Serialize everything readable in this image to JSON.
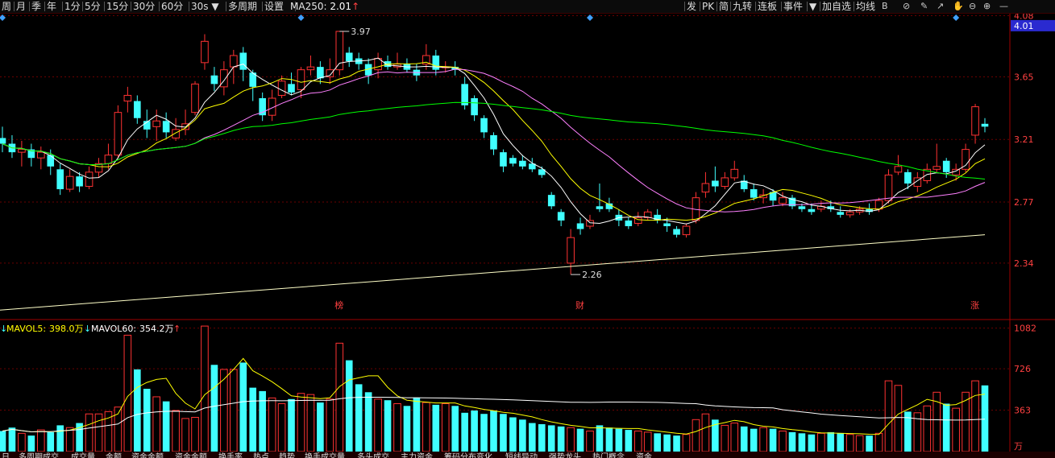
{
  "toolbar": {
    "left_items": [
      "周",
      "月",
      "季",
      "年",
      "1分",
      "5分",
      "15分",
      "30分",
      "60分",
      "30s ▼",
      "多周期",
      "设置"
    ],
    "ma250_label": "MA250:",
    "ma250_value": "2.01",
    "right_items": [
      "发",
      "PK",
      "简",
      "九转",
      "连板",
      "事件",
      "▼",
      "加自选",
      "均线"
    ]
  },
  "price_axis": {
    "ticks": [
      "4.08",
      "3.65",
      "3.21",
      "2.77",
      "2.34"
    ],
    "current": "4.01"
  },
  "volume_axis": {
    "ticks": [
      "1082",
      "726",
      "363"
    ],
    "unit": "万"
  },
  "volume_legend": {
    "mavol5_label": "MAVOL5:",
    "mavol5_value": "398.0万",
    "mavol60_label": "MAVOL60:",
    "mavol60_value": "354.2万"
  },
  "annotations": {
    "high": "3.97",
    "low": "2.26"
  },
  "event_markers": [
    "榜",
    "财",
    "涨"
  ],
  "bottom_tabs": [
    "日",
    "多周期成交",
    "成交量",
    "金额",
    "资金金额",
    "资金金额",
    "换手率",
    "热点",
    "趋势",
    "换手成交量",
    "多头成交",
    "主力资金",
    "筹码分布变化",
    "短线异动",
    "强势龙头",
    "热门概念",
    "资金"
  ],
  "colors": {
    "up": "#ff3232",
    "down": "#40ffff",
    "ma5": "#ffffff",
    "ma10": "#ffff00",
    "ma20": "#ff80ff",
    "ma60": "#00ff00",
    "ma250": "#ffffc8",
    "grid": "#6a0000"
  },
  "chart_data": {
    "type": "candlestick",
    "price_range": [
      2.0,
      4.1
    ],
    "volume_range": [
      0,
      1150
    ],
    "candles": [
      [
        3.22,
        3.18,
        3.3,
        3.12,
        180
      ],
      [
        3.18,
        3.12,
        3.24,
        3.08,
        210
      ],
      [
        3.12,
        3.14,
        3.2,
        3.02,
        160
      ],
      [
        3.14,
        3.08,
        3.18,
        3.02,
        140
      ],
      [
        3.08,
        3.12,
        3.16,
        3.0,
        190
      ],
      [
        3.1,
        3.02,
        3.14,
        2.96,
        170
      ],
      [
        3.0,
        2.86,
        3.04,
        2.82,
        230
      ],
      [
        2.86,
        2.95,
        3.0,
        2.84,
        210
      ],
      [
        2.95,
        2.88,
        2.98,
        2.84,
        250
      ],
      [
        2.88,
        2.98,
        3.02,
        2.86,
        330
      ],
      [
        2.98,
        3.04,
        3.08,
        2.94,
        330
      ],
      [
        3.04,
        3.1,
        3.18,
        3.0,
        350
      ],
      [
        3.1,
        3.4,
        3.45,
        3.08,
        390
      ],
      [
        3.48,
        3.52,
        3.58,
        3.4,
        1020
      ],
      [
        3.48,
        3.36,
        3.52,
        3.32,
        720
      ],
      [
        3.34,
        3.28,
        3.42,
        3.22,
        550
      ],
      [
        3.3,
        3.34,
        3.42,
        3.2,
        480
      ],
      [
        3.34,
        3.26,
        3.4,
        3.22,
        440
      ],
      [
        3.22,
        3.28,
        3.36,
        3.2,
        360
      ],
      [
        3.28,
        3.32,
        3.42,
        3.24,
        290
      ],
      [
        3.4,
        3.6,
        3.62,
        3.38,
        300
      ],
      [
        3.75,
        3.9,
        3.95,
        3.7,
        1100
      ],
      [
        3.66,
        3.6,
        3.72,
        3.55,
        760
      ],
      [
        3.58,
        3.7,
        3.76,
        3.52,
        720
      ],
      [
        3.72,
        3.8,
        3.84,
        3.6,
        720
      ],
      [
        3.82,
        3.7,
        3.86,
        3.62,
        780
      ],
      [
        3.68,
        3.58,
        3.7,
        3.48,
        560
      ],
      [
        3.5,
        3.38,
        3.54,
        3.34,
        530
      ],
      [
        3.38,
        3.5,
        3.56,
        3.34,
        470
      ],
      [
        3.52,
        3.62,
        3.66,
        3.5,
        420
      ],
      [
        3.6,
        3.54,
        3.68,
        3.52,
        460
      ],
      [
        3.56,
        3.7,
        3.72,
        3.5,
        510
      ],
      [
        3.7,
        3.72,
        3.8,
        3.66,
        500
      ],
      [
        3.72,
        3.64,
        3.76,
        3.6,
        430
      ],
      [
        3.65,
        3.7,
        3.78,
        3.6,
        460
      ],
      [
        3.7,
        3.97,
        3.97,
        3.66,
        950
      ],
      [
        3.82,
        3.76,
        3.86,
        3.72,
        800
      ],
      [
        3.78,
        3.74,
        3.82,
        3.7,
        590
      ],
      [
        3.74,
        3.66,
        3.78,
        3.6,
        520
      ],
      [
        3.7,
        3.78,
        3.82,
        3.64,
        460
      ],
      [
        3.76,
        3.72,
        3.8,
        3.7,
        450
      ],
      [
        3.72,
        3.74,
        3.82,
        3.7,
        420
      ],
      [
        3.74,
        3.7,
        3.78,
        3.68,
        400
      ],
      [
        3.7,
        3.66,
        3.74,
        3.62,
        470
      ],
      [
        3.74,
        3.8,
        3.88,
        3.7,
        430
      ],
      [
        3.8,
        3.7,
        3.84,
        3.66,
        410
      ],
      [
        3.72,
        3.72,
        3.76,
        3.68,
        420
      ],
      [
        3.72,
        3.7,
        3.76,
        3.66,
        400
      ],
      [
        3.6,
        3.45,
        3.65,
        3.42,
        340
      ],
      [
        3.5,
        3.38,
        3.52,
        3.34,
        360
      ],
      [
        3.36,
        3.26,
        3.38,
        3.22,
        330
      ],
      [
        3.24,
        3.14,
        3.26,
        3.1,
        360
      ],
      [
        3.12,
        3.02,
        3.14,
        2.98,
        330
      ],
      [
        3.08,
        3.04,
        3.1,
        3.02,
        300
      ],
      [
        3.06,
        3.02,
        3.1,
        3.0,
        280
      ],
      [
        3.04,
        3.0,
        3.08,
        2.98,
        250
      ],
      [
        3.0,
        2.96,
        3.02,
        2.94,
        240
      ],
      [
        2.82,
        2.74,
        2.84,
        2.72,
        230
      ],
      [
        2.7,
        2.64,
        2.72,
        2.6,
        220
      ],
      [
        2.34,
        2.52,
        2.58,
        2.26,
        210
      ],
      [
        2.62,
        2.58,
        2.66,
        2.54,
        200
      ],
      [
        2.6,
        2.64,
        2.68,
        2.58,
        180
      ],
      [
        2.74,
        2.72,
        2.9,
        2.7,
        230
      ],
      [
        2.76,
        2.72,
        2.8,
        2.7,
        210
      ],
      [
        2.68,
        2.64,
        2.72,
        2.6,
        200
      ],
      [
        2.64,
        2.6,
        2.66,
        2.58,
        190
      ],
      [
        2.62,
        2.66,
        2.7,
        2.6,
        180
      ],
      [
        2.66,
        2.7,
        2.72,
        2.64,
        170
      ],
      [
        2.68,
        2.64,
        2.72,
        2.62,
        160
      ],
      [
        2.62,
        2.6,
        2.66,
        2.56,
        150
      ],
      [
        2.58,
        2.54,
        2.6,
        2.52,
        140
      ],
      [
        2.54,
        2.6,
        2.62,
        2.52,
        150
      ],
      [
        2.64,
        2.8,
        2.84,
        2.62,
        280
      ],
      [
        2.84,
        2.9,
        2.98,
        2.8,
        330
      ],
      [
        2.92,
        2.88,
        3.02,
        2.84,
        280
      ],
      [
        2.88,
        2.94,
        2.98,
        2.86,
        230
      ],
      [
        2.94,
        3.0,
        3.06,
        2.92,
        250
      ],
      [
        2.92,
        2.86,
        2.96,
        2.84,
        220
      ],
      [
        2.86,
        2.8,
        2.9,
        2.78,
        200
      ],
      [
        2.8,
        2.82,
        2.86,
        2.76,
        210
      ],
      [
        2.84,
        2.78,
        2.86,
        2.74,
        200
      ],
      [
        2.76,
        2.8,
        2.84,
        2.74,
        180
      ],
      [
        2.8,
        2.74,
        2.82,
        2.72,
        170
      ],
      [
        2.74,
        2.72,
        2.76,
        2.7,
        160
      ],
      [
        2.72,
        2.7,
        2.76,
        2.68,
        150
      ],
      [
        2.72,
        2.74,
        2.78,
        2.7,
        160
      ],
      [
        2.74,
        2.72,
        2.78,
        2.7,
        170
      ],
      [
        2.7,
        2.68,
        2.74,
        2.66,
        160
      ],
      [
        2.68,
        2.7,
        2.72,
        2.66,
        150
      ],
      [
        2.7,
        2.72,
        2.74,
        2.68,
        140
      ],
      [
        2.72,
        2.7,
        2.76,
        2.68,
        140
      ],
      [
        2.72,
        2.78,
        2.8,
        2.7,
        160
      ],
      [
        2.78,
        2.96,
        3.0,
        2.76,
        620
      ],
      [
        2.98,
        3.02,
        3.1,
        2.96,
        580
      ],
      [
        2.98,
        2.9,
        3.0,
        2.86,
        350
      ],
      [
        2.88,
        2.94,
        2.98,
        2.84,
        340
      ],
      [
        2.92,
        3.0,
        3.04,
        2.9,
        400
      ],
      [
        3.0,
        3.02,
        3.18,
        2.98,
        520
      ],
      [
        3.06,
        2.98,
        3.08,
        2.94,
        420
      ],
      [
        2.96,
        3.0,
        3.04,
        2.92,
        380
      ],
      [
        3.0,
        3.14,
        3.18,
        2.98,
        520
      ],
      [
        3.24,
        3.44,
        3.46,
        3.18,
        620
      ],
      [
        3.32,
        3.3,
        3.36,
        3.26,
        580
      ]
    ],
    "ma250_start": 2.01,
    "ma250_end": 2.54
  }
}
